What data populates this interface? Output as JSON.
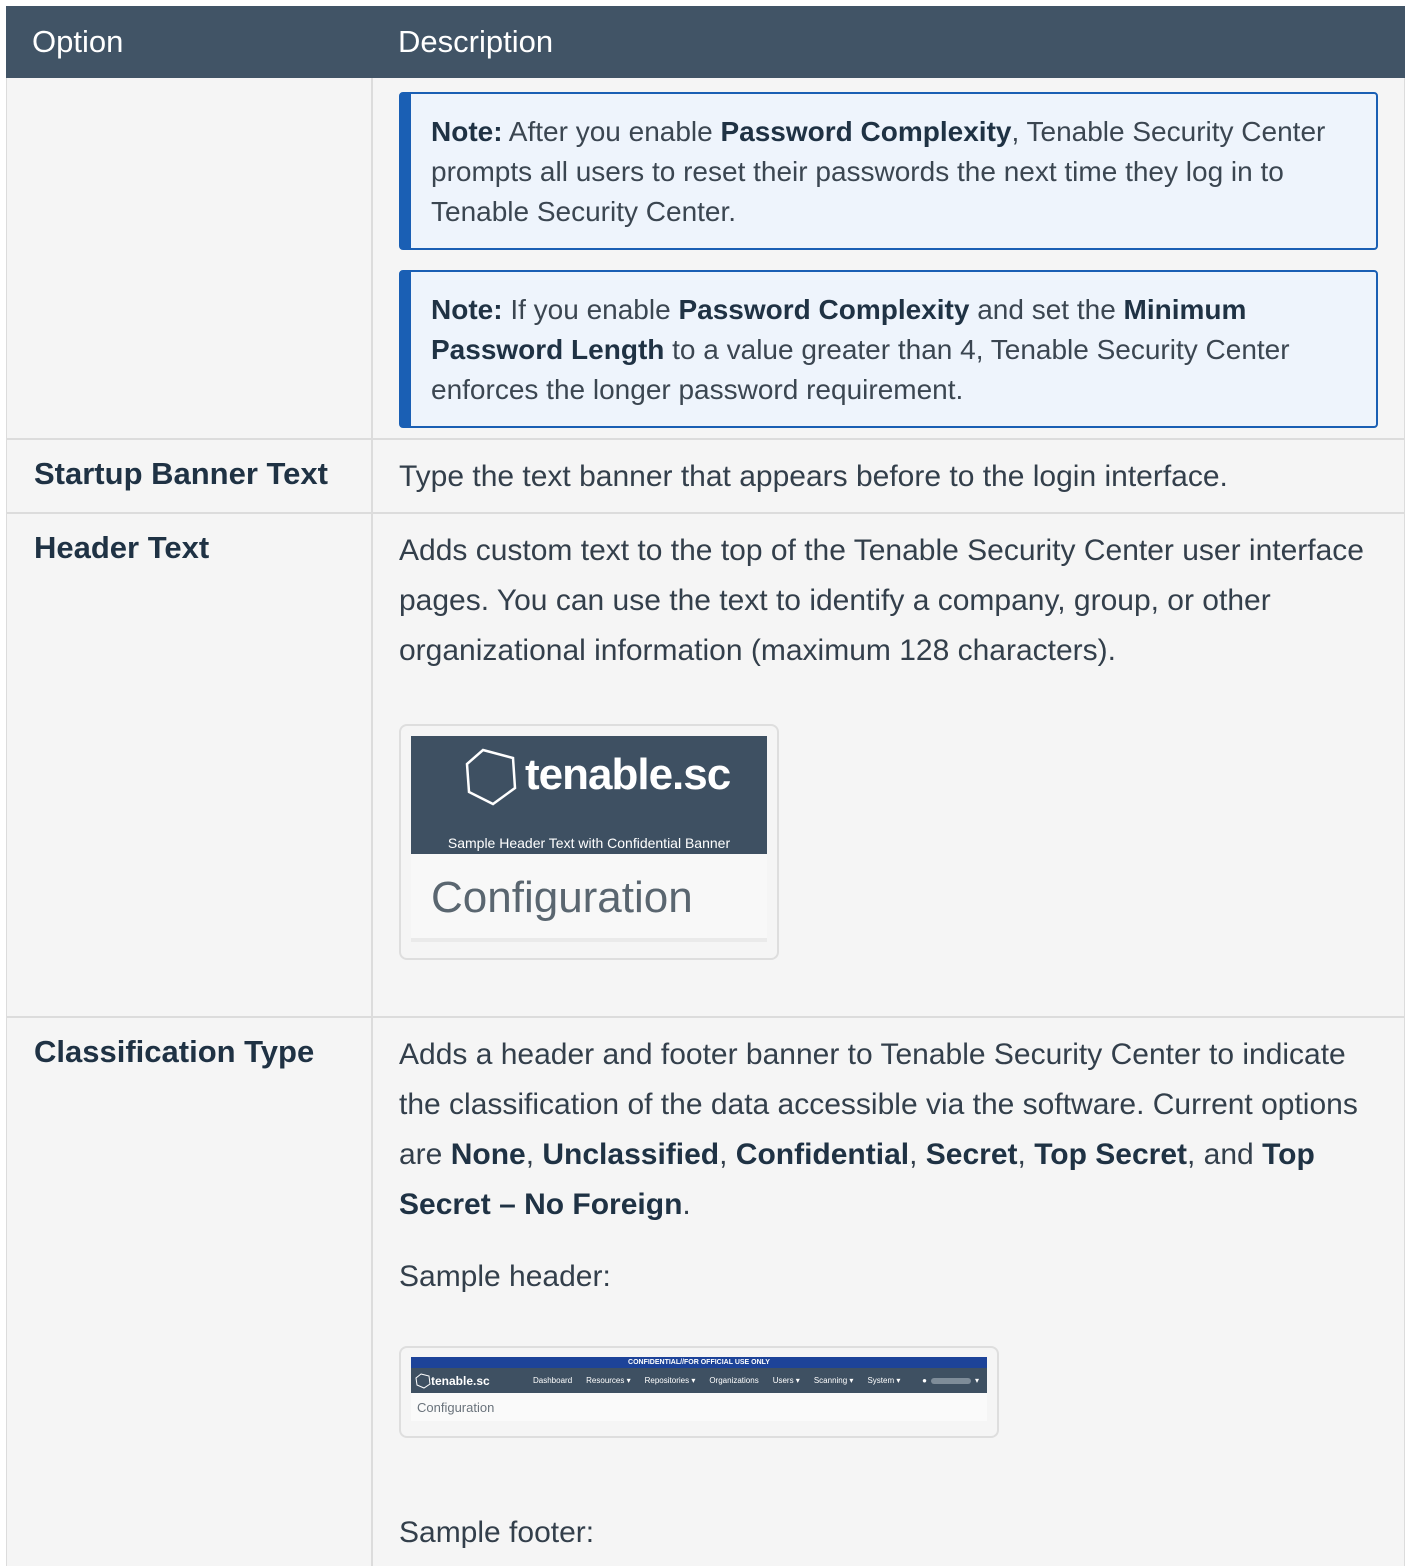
{
  "header": {
    "option": "Option",
    "description": "Description"
  },
  "notes": [
    {
      "label": "Note:",
      "parts": [
        " After you enable ",
        "Password Complexity",
        ", Tenable Security Center prompts all users to reset their passwords the next time they log in to Tenable Security Center."
      ]
    },
    {
      "label": "Note:",
      "parts": [
        " If you enable ",
        "Password Complexity",
        " and set the ",
        "Minimum Password Length",
        " to a value greater than 4, Tenable Security Center enforces the longer password requirement."
      ]
    }
  ],
  "rows": {
    "startup": {
      "option": "Startup Banner Text",
      "description": "Type the text banner that appears before to the login interface."
    },
    "header_text": {
      "option": "Header Text",
      "description": "Adds custom text to the top of the Tenable Security Center user interface pages. You can use the text to identify a company, group, or other organizational information (maximum 128 characters).",
      "sample": {
        "brand": "tenable.sc",
        "subtitle": "Sample Header Text with Confidential Banner",
        "page": "Configuration"
      }
    },
    "classification": {
      "option": "Classification Type",
      "desc_parts": [
        "Adds a header and footer banner to Tenable Security Center to indicate the classification of the data accessible via the software. Current options are ",
        "None",
        ", ",
        "Unclassified",
        ", ",
        "Confidential",
        ", ",
        "Secret",
        ", ",
        "Top Secret",
        ", and ",
        "Top Secret – No Foreign",
        "."
      ],
      "sample_header_label": "Sample header:",
      "sample_footer_label": "Sample footer:",
      "sample": {
        "classification": "CONFIDENTIAL//FOR OFFICIAL USE ONLY",
        "brand": "tenable.sc",
        "nav": [
          "Dashboard",
          "Resources ▾",
          "Repositories ▾",
          "Organizations",
          "Users ▾",
          "Scanning ▾",
          "System ▾"
        ],
        "page": "Configuration"
      }
    }
  },
  "colors": {
    "header_bg": "#415466",
    "note_accent": "#1a5fb4",
    "classification_banner": "#1d4399"
  }
}
